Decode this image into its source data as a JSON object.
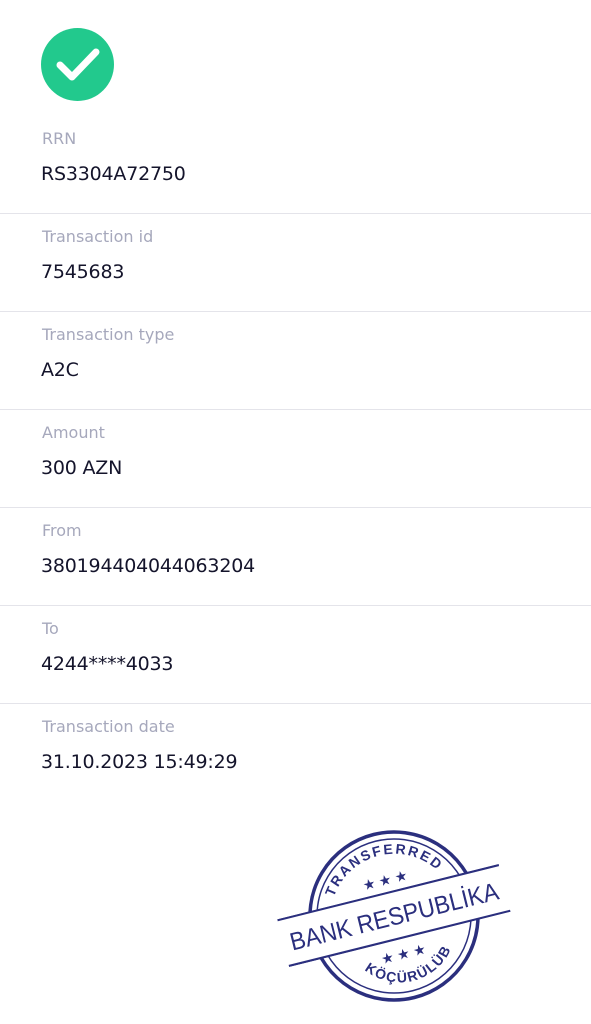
{
  "status": {
    "icon": "check-circle-icon",
    "color": "#22c98d"
  },
  "details": [
    {
      "label": "RRN",
      "value": "RS3304A72750"
    },
    {
      "label": "Transaction id",
      "value": "7545683"
    },
    {
      "label": "Transaction type",
      "value": "A2C"
    },
    {
      "label": "Amount",
      "value": "300 AZN"
    },
    {
      "label": "From",
      "value": "380194404044063204"
    },
    {
      "label": "To",
      "value": "4244****4033"
    },
    {
      "label": "Transaction date",
      "value": "31.10.2023 15:49:29"
    }
  ],
  "stamp": {
    "top_text": "TRANSFERRED",
    "center_text": "BANK RESPUBLİKA",
    "bottom_text": "KÖÇÜRÜLÜB",
    "color": "#2b2f7e"
  }
}
